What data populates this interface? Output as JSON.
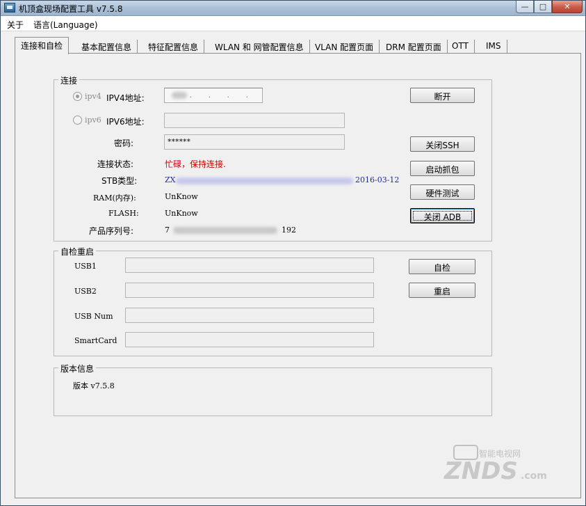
{
  "window": {
    "title": "机顶盒现场配置工具 v7.5.8"
  },
  "menu": {
    "items": [
      "关于",
      "语言(Language)"
    ]
  },
  "tabs": [
    "连接和自检",
    "基本配置信息",
    "特征配置信息",
    "WLAN 和 网管配置信息",
    "VLAN 配置页面",
    "DRM 配置页面",
    "OTT",
    "IMS"
  ],
  "connect": {
    "group_title": "连接",
    "ipv4_radio": "ipv4",
    "ipv4_label": "IPV4地址:",
    "ipv4_value": ". . . .",
    "ipv6_radio": "ipv6",
    "ipv6_label": "IPV6地址:",
    "ipv6_value": "",
    "password_label": "密码:",
    "password_value": "******",
    "status_label": "连接状态:",
    "status_value": "忙碌，保持连接.",
    "stb_label": "STB类型:",
    "stb_value_start": "ZX",
    "stb_value_end": "2016-03-12",
    "ram_label": "RAM(内存):",
    "ram_value": "UnKnow",
    "flash_label": "FLASH:",
    "flash_value": "UnKnow",
    "serial_label": "产品序列号:",
    "serial_value_start": "7",
    "serial_value_end": "192",
    "disconnect_button": "断开",
    "close_ssh_button": "关闭SSH",
    "start_capture_button": "启动抓包",
    "hardware_test_button": "硬件测试",
    "close_adb_button": "关闭 ADB"
  },
  "selftest": {
    "group_title": "自检重启",
    "usb1_label": "USB1",
    "usb2_label": "USB2",
    "usbnum_label": "USB Num",
    "smartcard_label": "SmartCard",
    "selftest_button": "自检",
    "restart_button": "重启"
  },
  "version": {
    "group_title": "版本信息",
    "text": "版本 v7.5.8"
  },
  "watermark": {
    "text": "ZNDS",
    "suffix": ".com",
    "slogan": "智能电视网"
  }
}
